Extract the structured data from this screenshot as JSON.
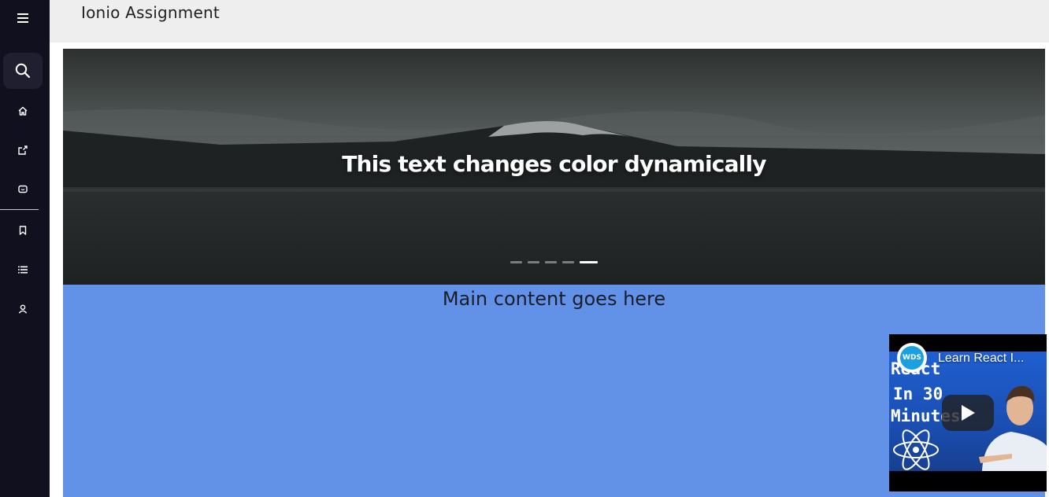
{
  "header": {
    "title": "Ionio Assignment"
  },
  "sidebar": {
    "items": [
      {
        "name": "menu",
        "icon": "menu-icon"
      },
      {
        "name": "search",
        "icon": "search-icon",
        "active": true
      },
      {
        "name": "home",
        "icon": "home-icon"
      },
      {
        "name": "export",
        "icon": "export-icon"
      },
      {
        "name": "chat",
        "icon": "chat-icon"
      },
      {
        "name": "bookmark",
        "icon": "bookmark-icon"
      },
      {
        "name": "list",
        "icon": "list-icon"
      },
      {
        "name": "profile",
        "icon": "user-icon"
      }
    ]
  },
  "hero": {
    "text": "This text changes color dynamically",
    "dots_total": 5,
    "active_dot": 5
  },
  "main": {
    "text": "Main content goes here"
  },
  "video": {
    "title": "Learn React I...",
    "channel_badge": "WDS",
    "thumbnail_lines": [
      "React",
      "In 30",
      "Minutes"
    ]
  },
  "colors": {
    "sidebar_bg": "#10101e",
    "header_bg": "#eeeeee",
    "content_bg": "#6192e8"
  }
}
